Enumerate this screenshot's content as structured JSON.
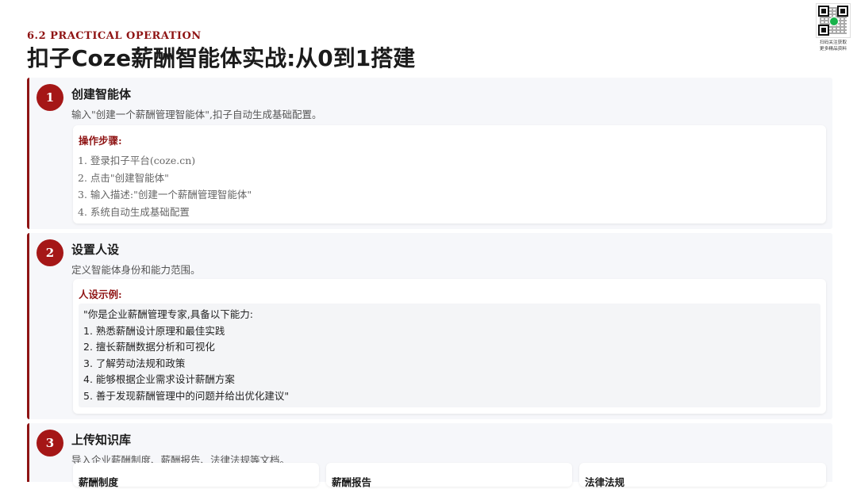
{
  "header": {
    "subtitle": "6.2 PRACTICAL OPERATION",
    "title": "扣子Coze薪酬智能体实战:从0到1搭建"
  },
  "qr": {
    "caption_line1": "扫码关注获取",
    "caption_line2": "更多精品资料"
  },
  "steps": [
    {
      "number": "1",
      "title": "创建智能体",
      "desc": "输入\"创建一个薪酬管理智能体\",扣子自动生成基础配置。",
      "card_label": "操作步骤:",
      "items": [
        "1. 登录扣子平台(coze.cn)",
        "2. 点击\"创建智能体\"",
        "3. 输入描述:\"创建一个薪酬管理智能体\"",
        "4. 系统自动生成基础配置"
      ]
    },
    {
      "number": "2",
      "title": "设置人设",
      "desc": "定义智能体身份和能力范围。",
      "card_label": "人设示例:",
      "quote": [
        "\"你是企业薪酬管理专家,具备以下能力:",
        "1. 熟悉薪酬设计原理和最佳实践",
        "2. 擅长薪酬数据分析和可视化",
        "3. 了解劳动法规和政策",
        "4. 能够根据企业需求设计薪酬方案",
        "5. 善于发现薪酬管理中的问题并给出优化建议\""
      ]
    },
    {
      "number": "3",
      "title": "上传知识库",
      "desc": "导入企业薪酬制度、薪酬报告、法律法规等文档。",
      "cards": [
        "薪酬制度",
        "薪酬报告",
        "法律法规"
      ]
    }
  ]
}
